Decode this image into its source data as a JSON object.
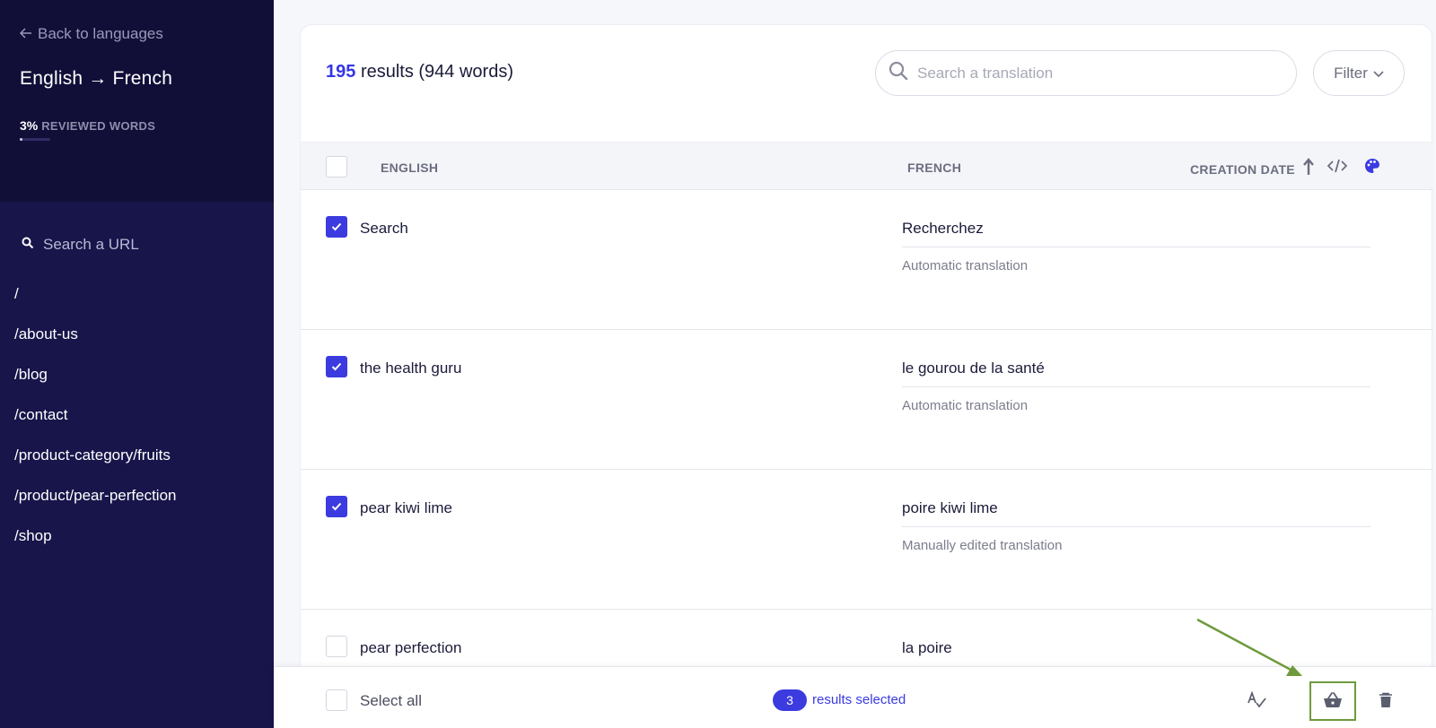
{
  "sidebar": {
    "back_label": "Back to languages",
    "language_pair": "English → French",
    "reviewed_percent": "3%",
    "reviewed_label": "REVIEWED WORDS",
    "reviewed_fraction": 0.03,
    "url_search_placeholder": "Search a URL",
    "urls": [
      "/",
      "/about-us",
      "/blog",
      "/contact",
      "/product-category/fruits",
      "/product/pear-perfection",
      "/shop"
    ]
  },
  "header": {
    "result_count": "195",
    "result_text": "results (944 words)",
    "search_placeholder": "Search a translation",
    "filter_label": "Filter"
  },
  "table": {
    "columns": {
      "source": "ENGLISH",
      "target": "FRENCH",
      "date": "CREATION DATE"
    },
    "rows": [
      {
        "source": "Search",
        "target": "Recherchez",
        "status": "Automatic translation",
        "checked": true
      },
      {
        "source": "the health guru",
        "target": "le gourou de la santé",
        "status": "Automatic translation",
        "checked": true
      },
      {
        "source": "pear kiwi lime",
        "target": "poire kiwi lime",
        "status": "Manually edited translation",
        "checked": true
      },
      {
        "source": "pear perfection",
        "target": "la poire",
        "status": "",
        "checked": false
      }
    ]
  },
  "bottom_bar": {
    "select_all_label": "Select all",
    "selected_count": "3",
    "selected_label": "results selected"
  },
  "colors": {
    "sidebar_bg": "#17154a",
    "accent": "#3b3be0",
    "annotation": "#6e9a3c"
  }
}
